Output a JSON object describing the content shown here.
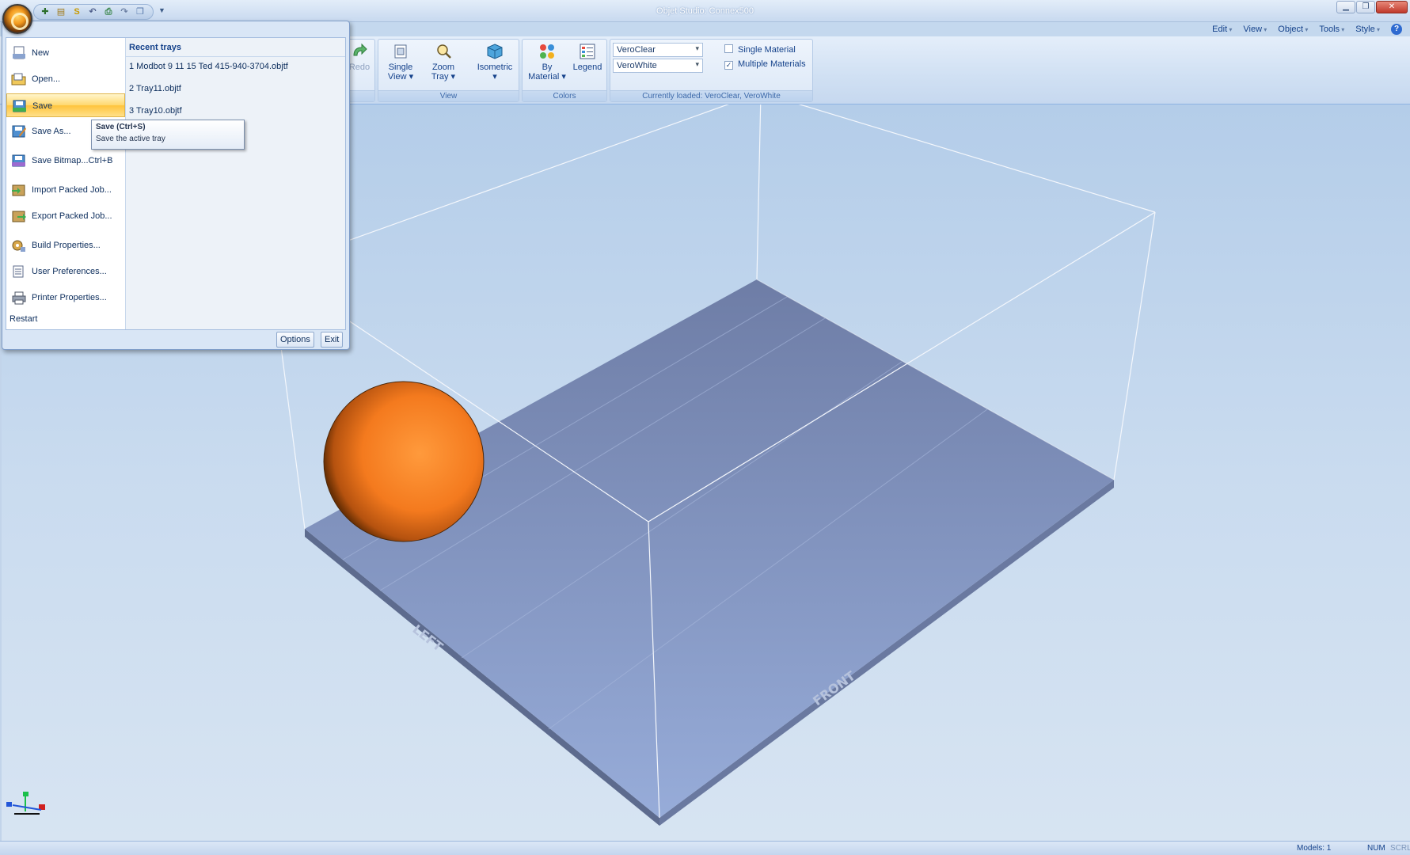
{
  "window": {
    "title": "Objet Studio: Connex500"
  },
  "quick_access": {
    "icons": [
      "new-tray-icon",
      "open-icon",
      "save-s-icon",
      "undo-icon",
      "printer-icon",
      "redo-icon",
      "window-icon"
    ]
  },
  "right_menu": [
    "Edit",
    "View",
    "Object",
    "Tools",
    "Style"
  ],
  "ribbon": {
    "redo_label": "Redo",
    "view_group": {
      "label": "View",
      "buttons": [
        {
          "label1": "Single",
          "label2": "View"
        },
        {
          "label1": "Zoom",
          "label2": "Tray"
        },
        {
          "label1": "Isometric",
          "label2": ""
        }
      ]
    },
    "colors_group": {
      "label": "Colors",
      "buttons": [
        {
          "label1": "By",
          "label2": "Material"
        },
        {
          "label1": "Legend",
          "label2": ""
        }
      ]
    },
    "materials_group": {
      "combo1": "VeroClear",
      "combo2": "VeroWhite",
      "single_material": "Single Material",
      "multiple_materials": "Multiple Materials",
      "single_checked": false,
      "multiple_checked": true,
      "label": "Currently loaded: VeroClear, VeroWhite"
    }
  },
  "app_menu": {
    "items": [
      {
        "label": "New",
        "icon": "new-document-icon"
      },
      {
        "label": "Open...",
        "icon": "open-folder-icon"
      },
      {
        "label": "Save",
        "icon": "save-icon",
        "selected": true
      },
      {
        "label": "Save As...",
        "icon": "save-as-icon"
      },
      {
        "label": "Save Bitmap...Ctrl+B",
        "icon": "save-bitmap-icon"
      },
      {
        "label": "Import Packed Job...",
        "icon": "import-packed-job-icon"
      },
      {
        "label": "Export Packed Job...",
        "icon": "export-packed-job-icon"
      },
      {
        "label": "Build Properties...",
        "icon": "build-properties-icon"
      },
      {
        "label": "User Preferences...",
        "icon": "user-preferences-icon"
      },
      {
        "label": "Printer Properties...",
        "icon": "printer-properties-icon"
      }
    ],
    "restart": "Restart",
    "recent_header": "Recent trays",
    "recent": [
      "1 Modbot 9 11 15 Ted 415-940-3704.objtf",
      "2 Tray11.objtf",
      "3 Tray10.objtf"
    ],
    "options": "Options",
    "exit": "Exit"
  },
  "tooltip": {
    "title": "Save (Ctrl+S)",
    "desc": "Save the active tray"
  },
  "scene": {
    "tray_left_label": "LEFT",
    "tray_front_label": "FRONT",
    "sphere_color": "#f5821f",
    "tray_color": "#7d8fba"
  },
  "status": {
    "models": "Models: 1",
    "num": "NUM",
    "scrl": "SCRL"
  }
}
